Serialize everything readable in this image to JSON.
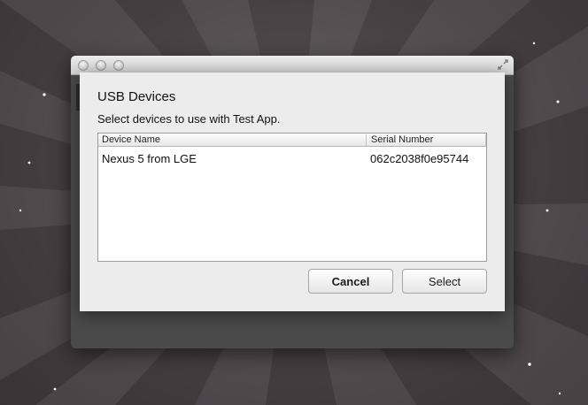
{
  "dialog": {
    "title": "USB Devices",
    "description": "Select devices to use with Test App."
  },
  "table": {
    "columns": [
      "Device Name",
      "Serial Number"
    ],
    "rows": [
      {
        "name": "Nexus 5 from LGE",
        "serial": "062c2038f0e95744"
      }
    ]
  },
  "buttons": {
    "cancel": "Cancel",
    "select": "Select"
  },
  "icons": {
    "window_controls": [
      "close-icon",
      "minimize-icon",
      "zoom-icon"
    ],
    "fullscreen": "fullscreen-icon"
  },
  "colors": {
    "backdrop": "#453e41",
    "dialog_bg": "#ececec",
    "parent_window_bg": "#4a4a4a"
  }
}
